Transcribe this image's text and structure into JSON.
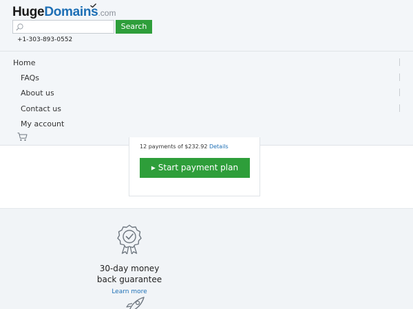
{
  "header": {
    "logo": {
      "part1": "Huge",
      "part2": "Domains",
      "part3": ".com"
    },
    "search": {
      "placeholder": "",
      "value": "",
      "button_label": "Search"
    },
    "phone": "+1-303-893-0552"
  },
  "nav": {
    "items": [
      {
        "label": "Home"
      },
      {
        "label": "FAQs"
      },
      {
        "label": "About us"
      },
      {
        "label": "Contact us"
      },
      {
        "label": "My account"
      }
    ],
    "cart_icon": "cart-icon"
  },
  "payment": {
    "line": "12 payments of $232.92",
    "details_link": "Details",
    "button_label": "▸ Start payment plan"
  },
  "feature": {
    "icon": "award-ribbon-icon",
    "title_line1": "30-day money",
    "title_line2": "back guarantee",
    "link": "Learn more",
    "next_icon": "rocket-icon"
  },
  "colors": {
    "brand_blue": "#1d6fb5",
    "action_green": "#2e9e3a",
    "background": "#f1f4f7"
  }
}
